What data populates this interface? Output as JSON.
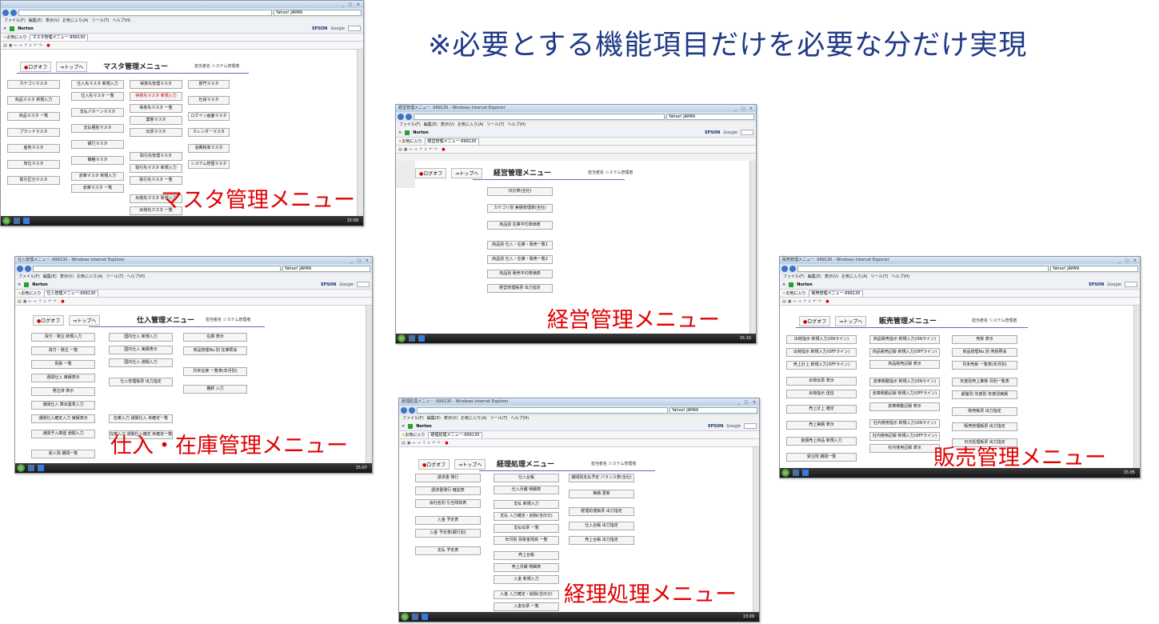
{
  "headline": "※必要とする機能項目だけを必要な分だけ実現",
  "browser": {
    "menu_items": [
      "ファイル(F)",
      "編集(E)",
      "表示(V)",
      "お気に入り(A)",
      "ツール(T)",
      "ヘルプ(H)"
    ],
    "search_text": "Yahoo! JAPAN",
    "norton": "Norton",
    "epson": "EPSON",
    "google": "Google",
    "favorites": "お気に入り",
    "ie_suffix": " - Windows Internet Explorer"
  },
  "common": {
    "logoff": "ログオフ",
    "logoff_mark": "●",
    "top": "⇒トップへ",
    "user": "担当者名 システム管理者"
  },
  "screens": {
    "master": {
      "caption": "マスタ管理メニュー",
      "title": "マスタ管理メニュー",
      "tab": "マスタ管理メニュー-999130",
      "clock": "15:09",
      "col1": [
        "カテゴリマスタ",
        "商品マスタ 新規入力",
        "商品マスタ 一覧",
        "ブランドマスタ",
        "産地マスタ",
        "単位マスタ",
        "取引区分マスタ"
      ],
      "col2": [
        "仕入先マスタ 新規入力",
        "仕入先マスタ 一覧",
        "支払パターンマスタ",
        "支払種別マスタ",
        "銀行マスタ",
        "職種マスタ",
        "倉庫マスタ 新規入力",
        "倉庫マスタ 一覧"
      ],
      "col3": [
        "得意先管理マスタ",
        "得意先マスタ 新規入力",
        "得意先マスタ 一覧",
        "業態マスタ",
        "伝票マスタ",
        "取引先管理マスタ",
        "取引先マスタ 新規入力",
        "取引先マスタ 一覧",
        "出荷先マスタ 新規入力",
        "出荷先マスタ 一覧",
        "運送店マスタ"
      ],
      "col4": [
        "部門マスタ",
        "社員マスタ",
        "ログイン画面マスタ",
        "カレンダーマスタ",
        "消費税率マスタ",
        "システム管理マスタ"
      ]
    },
    "keiei": {
      "caption": "経営管理メニュー",
      "title": "経営管理メニュー",
      "window_title": "経営管理メニュー -999130",
      "tab": "経営管理メニュー-999130",
      "clock": "15:10",
      "buttons": [
        "日計表(全社)",
        "カテゴリ別 実績管理表(全社)",
        "商品別 在庫平均単価表",
        "商品別 仕入・在庫・販売一覧1",
        "商品別 仕入・在庫・販売一覧2",
        "商品別 販売平均単価表",
        "経営管理帳票 出力指定"
      ]
    },
    "shiire": {
      "caption": "仕入・在庫管理メニュー",
      "title": "仕入管理メニュー",
      "window_title": "仕入管理メニュー -999130",
      "tab": "仕入管理メニュー-999130",
      "clock": "15:07",
      "col1": [
        "買付・発注 新規入力",
        "買付・発注 一覧",
        "買掛 一覧",
        "週間仕入 実績表示",
        "発注済 表示",
        "通関仕入 算出基準入力",
        "通関仕入確定入力 実績表示",
        "通関予入庫登 通関入力",
        "受入残 期間一覧"
      ],
      "col2": [
        "国内仕入 新規入力",
        "国内仕入 実績表示",
        "国内仕入 通関入力",
        "仕入管理帳票 出力指定",
        "在庫入力 通関仕入 未確定一覧",
        "在庫入力 通関仕入確定 未確定一覧"
      ],
      "col3": [
        "在庫 表示",
        "商品管理No.別 在庫照会",
        "月末在庫 一覧表(年月別)",
        "棚卸 入力"
      ]
    },
    "keiri": {
      "caption": "経理処理メニュー",
      "title": "経理処理メニュー",
      "window_title": "経理処理メニュー -999130",
      "tab": "経理処理メニュー-999130",
      "clock": "13:09",
      "col1": [
        "請求書 発行",
        "請求書発行 確認表",
        "会社名別 引当残高表",
        "入金 予定表",
        "入金 予定表(銀行別)",
        "支払 予定表",
        "支払手形台帳",
        "受取手形台帳"
      ],
      "col2": [
        "仕入台帳",
        "仕入月報 明細表",
        "支払 新規入力",
        "支払 入力確定・削除(当日分)",
        "支払伝票 一覧",
        "年月別 買掛金残高 一覧",
        "売上台帳",
        "売上月報 明細表",
        "入金 新規入力",
        "入金 入力確定・削除(当日分)",
        "入金伝票 一覧"
      ],
      "col3": [
        "期間別支払予定 バランス表(全社)",
        "実績 更新",
        "経理処理帳票 出力指定",
        "仕入台帳 出力指定",
        "売上台帳 出力指定"
      ]
    },
    "hanbai": {
      "caption": "販売管理メニュー",
      "title": "販売管理メニュー",
      "window_title": "販売管理メニュー -999130",
      "tab": "販売管理メニュー-999130",
      "clock": "15:05",
      "col1": [
        "出荷指示 新規入力(ONライン)",
        "出荷指示 新規入力(OFFライン)",
        "売上計上 新規入力(OFFライン)",
        "出荷伝票 表示",
        "出荷指示 送信",
        "売上計上 確定",
        "売上実績 表示",
        "金額売上商品 新規入力",
        "受注残 期間一覧"
      ],
      "col2": [
        "商品販売指示 新規入力(ONライン)",
        "商品販売記録 新規入力(OFFライン)",
        "商品販売記録 表示",
        "倉庫移動指示 新規入力(ONライン)",
        "倉庫移動記録 新規入力(OFFライン)",
        "倉庫移動記録 表示",
        "社内使用指示 新規入力(ONライン)",
        "社内使用記録 新規入力(OFFライン)",
        "社内使用記録 表示"
      ],
      "col3": [
        "売掛 表示",
        "商品管理No.別 売掛照会",
        "月末売掛 一覧表(年月別)",
        "年度別売上推移 月別一覧表",
        "顧客別 年度別 年度別実績",
        "販売帳票 出力指定",
        "販売管理帳票 出力指定",
        "日次処理帳票 出力指定"
      ]
    }
  }
}
